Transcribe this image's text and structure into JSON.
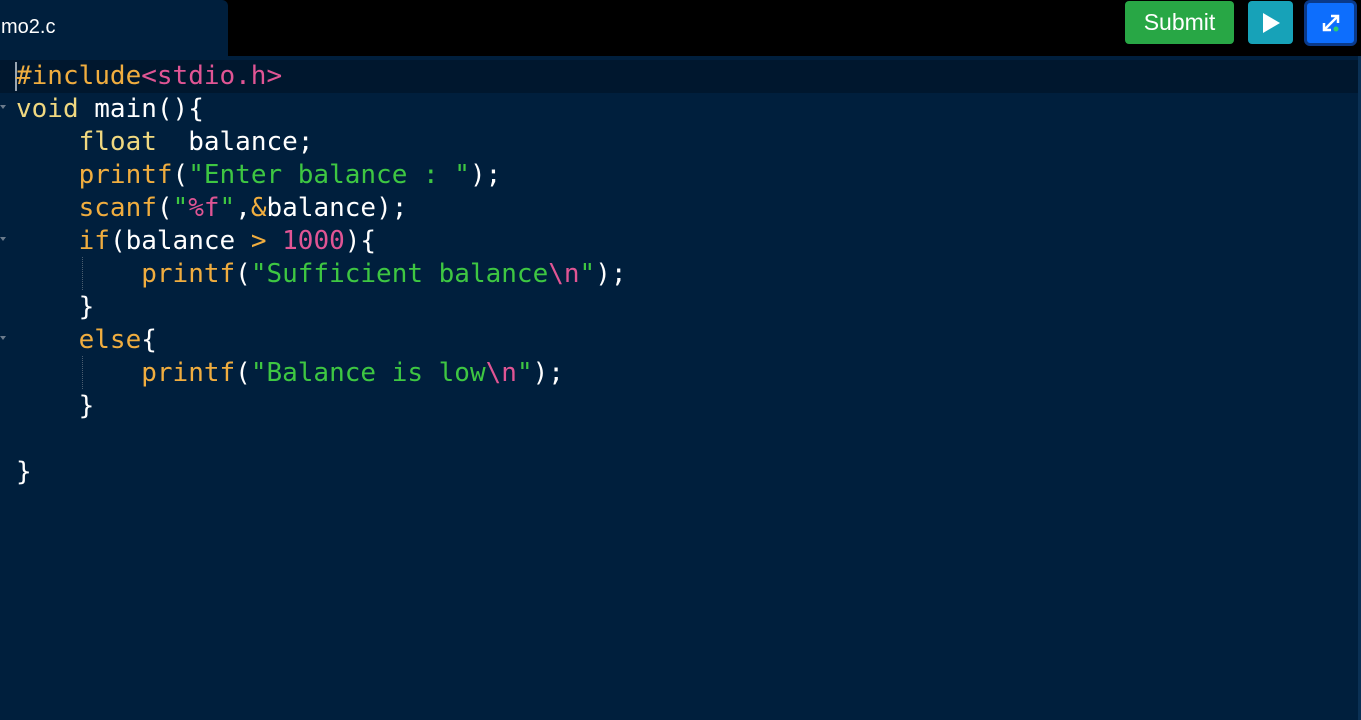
{
  "tab": {
    "filename": "mo2.c"
  },
  "toolbar": {
    "submit_label": "Submit",
    "run_icon": "play-icon",
    "expand_icon": "fullscreen-icon"
  },
  "colors": {
    "background": "#001f3d",
    "keyword": "#f0ad3f",
    "string": "#3ec742",
    "number": "#e05594",
    "submit": "#28a745",
    "run": "#17a2b8",
    "expand": "#0d6efd"
  },
  "code": {
    "l1": {
      "a": "#include",
      "b": "<stdio.h>"
    },
    "l2": {
      "a": "void",
      "b": " main(){"
    },
    "l3": {
      "a": "    ",
      "b": "float",
      "c": "  balance;"
    },
    "l4": {
      "a": "    ",
      "b": "printf",
      "c": "(",
      "d": "\"Enter balance : \"",
      "e": ");"
    },
    "l5": {
      "a": "    ",
      "b": "scanf",
      "c": "(",
      "d": "\"",
      "e": "%f",
      "f": "\"",
      "g": ",",
      "h": "&",
      "i": "balance);"
    },
    "l6": {
      "a": "    ",
      "b": "if",
      "c": "(balance ",
      "d": ">",
      "e": " ",
      "f": "1000",
      "g": "){"
    },
    "l7": {
      "a": "        ",
      "b": "printf",
      "c": "(",
      "d": "\"Sufficient balance",
      "e": "\\n",
      "f": "\"",
      "g": ");"
    },
    "l8": {
      "a": "    }"
    },
    "l9": {
      "a": "    ",
      "b": "else",
      "c": "{"
    },
    "l10": {
      "a": "        ",
      "b": "printf",
      "c": "(",
      "d": "\"Balance is low",
      "e": "\\n",
      "f": "\"",
      "g": ");"
    },
    "l11": {
      "a": "    }"
    },
    "l12": {
      "a": ""
    },
    "l13": {
      "a": "}"
    }
  }
}
